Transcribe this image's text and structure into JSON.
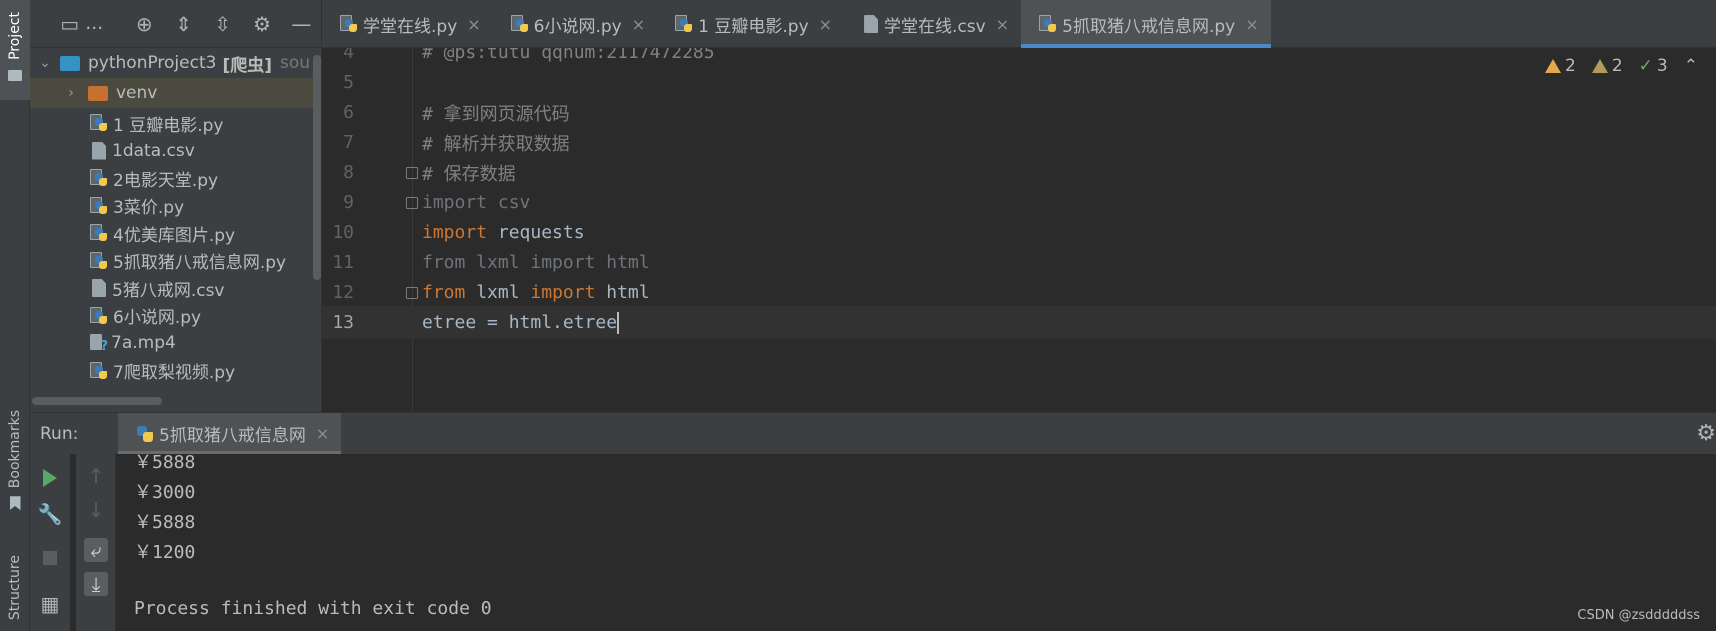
{
  "left_strip": {
    "project": "Project",
    "bookmarks": "Bookmarks",
    "structure": "Structure"
  },
  "project_panel": {
    "toolbar_dots": "…",
    "tree": [
      {
        "label": "pythonProject3",
        "tag": "[爬虫]",
        "extra": "sou",
        "kind": "root-folder"
      },
      {
        "label": "venv",
        "kind": "folder"
      },
      {
        "label": "1 豆瓣电影.py",
        "kind": "py"
      },
      {
        "label": "1data.csv",
        "kind": "file"
      },
      {
        "label": "2电影天堂.py",
        "kind": "py"
      },
      {
        "label": "3菜价.py",
        "kind": "py"
      },
      {
        "label": "4优美库图片.py",
        "kind": "py"
      },
      {
        "label": "5抓取猪八戒信息网.py",
        "kind": "py"
      },
      {
        "label": "5猪八戒网.csv",
        "kind": "file"
      },
      {
        "label": "6小说网.py",
        "kind": "py"
      },
      {
        "label": "7a.mp4",
        "kind": "unknown"
      },
      {
        "label": "7爬取梨视频.py",
        "kind": "py"
      }
    ]
  },
  "editor_tabs": [
    {
      "label": "学堂在线.py",
      "kind": "py"
    },
    {
      "label": "6小说网.py",
      "kind": "py"
    },
    {
      "label": "1 豆瓣电影.py",
      "kind": "py"
    },
    {
      "label": "学堂在线.csv",
      "kind": "file"
    },
    {
      "label": "5抓取猪八戒信息网.py",
      "kind": "py",
      "active": true
    }
  ],
  "inspections": {
    "warnings": "2",
    "weak_warnings": "2",
    "ok": "3"
  },
  "code_lines": [
    {
      "ln": "4",
      "text": "# @ps:tutu qqnum:2117472285"
    },
    {
      "ln": "5",
      "text": ""
    },
    {
      "ln": "6",
      "text": "# 拿到网页源代码"
    },
    {
      "ln": "7",
      "text": "# 解析并获取数据"
    },
    {
      "ln": "8",
      "text": "# 保存数据"
    },
    {
      "ln": "9",
      "kw": "",
      "text": "import csv"
    },
    {
      "ln": "10",
      "kw": "import",
      "text": " requests"
    },
    {
      "ln": "11",
      "text": "from lxml import html"
    },
    {
      "ln": "12",
      "kw1": "from",
      "mid": " lxml ",
      "kw2": "import",
      "rest": " html"
    },
    {
      "ln": "13",
      "text": "etree = html.etree"
    }
  ],
  "run": {
    "label": "Run:",
    "tab": "5抓取猪八戒信息网",
    "console": [
      "￥5888",
      "￥3000",
      "￥5888",
      "￥1200",
      "",
      "Process finished with exit code 0"
    ]
  },
  "watermark": "CSDN @zsdddddss"
}
